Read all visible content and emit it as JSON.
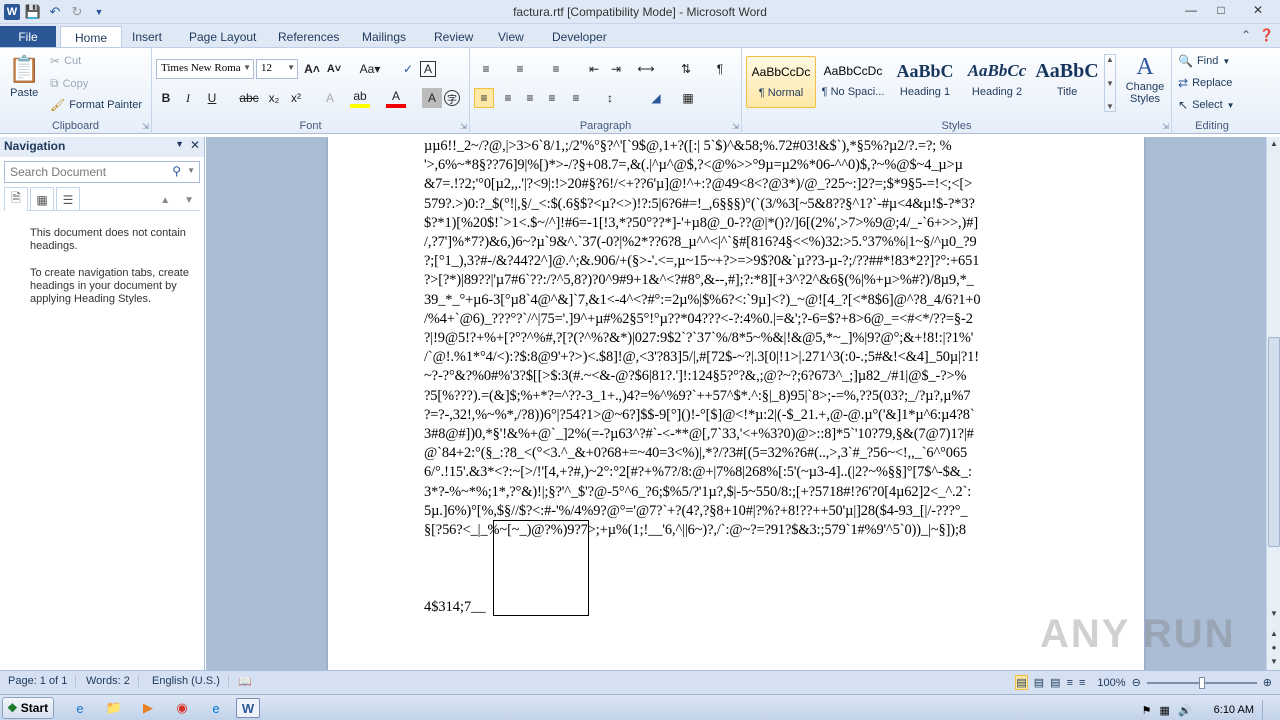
{
  "window": {
    "title": "factura.rtf [Compatibility Mode]  -  Microsoft Word"
  },
  "tabs": [
    "File",
    "Home",
    "Insert",
    "Page Layout",
    "References",
    "Mailings",
    "Review",
    "View",
    "Developer"
  ],
  "clipboard": {
    "paste": "Paste",
    "cut": "Cut",
    "copy": "Copy",
    "format_painter": "Format Painter",
    "label": "Clipboard"
  },
  "font": {
    "name": "Times New Roma",
    "size": "12",
    "label": "Font"
  },
  "paragraph": {
    "label": "Paragraph"
  },
  "styles": {
    "label": "Styles",
    "items": [
      {
        "preview": "AaBbCcDc",
        "name": "¶ Normal"
      },
      {
        "preview": "AaBbCcDc",
        "name": "¶ No Spaci..."
      },
      {
        "preview": "AaBbC",
        "name": "Heading 1"
      },
      {
        "preview": "AaBbCc",
        "name": "Heading 2"
      },
      {
        "preview": "AaBbC",
        "name": "Title"
      }
    ],
    "change": "Change Styles"
  },
  "editing": {
    "find": "Find",
    "replace": "Replace",
    "select": "Select",
    "label": "Editing"
  },
  "navigation": {
    "title": "Navigation",
    "search_placeholder": "Search Document",
    "msg1": "This document does not contain headings.",
    "msg2": "To create navigation tabs, create headings in your document by applying Heading Styles."
  },
  "document": {
    "lines": [
      "µµ6!!_2~/?@,|>3>6`8/1,;/2'%°§?^'[`9$@,1+?([:| 5`$)^&58;%.72#03!&$`),*§5%?µ2/?.=?; %",
      "'>,6%~*8§??76]9|%[)*>-/?§+08.7=,&(.|^µ^@$,?<@%>>°9µ=µ2%*06-^^0)$,?~%@$~4_µ>µ",
      "&7=.!?2;'°0[µ2,,.'|?<9|:!>20#§?6!/<+??6'µ]@!^+:?@49<8<?@3*)/@_?25~:]2?=;$*9§5-=!<;<[>",
      "579?.>)0:?_$(°!|,§/_<:$(.6§$?<µ?<>)!?:5|6?6#=!_,6§§§)°(`(3/%3[~5&8??§^1?`-#µ<4&µ!$-?*3?",
      "$?*1)[%20$!`>1<.$~/^]!#6=-1[!3,*?50°??*]-'+µ8@_0-??@|*()?/]6[(2%',>7>%9@;4/_-`6+>>,)#]",
      "/,?7']%*7?)&6,)6~?µ`9&^.`37(-0?|%2*??6?8_µ^^<|^`§#[816?4§<<%)32:>5.°37%%|1~§/^µ0_?9",
      "?;[°1_),3?#-/&?44?2^]@.^;&.906/+(§>-'.<=,µ~15~+?>=>9$?0&`µ??3-µ-?;/??##*!83*2?]?°:+651",
      "?>[?*)|89??|'µ7#6`??:/?^5,8?)?0^9#9+1&^<?#8°,&--,#];?:*8][+3^?2^&6§(%|%+µ>%#?)/8µ9,*_",
      "39_*_°+µ6-3[°µ8`4@^&]`7,&1<-4^<?#°:=2µ%|$%6?<:`9µ]<?)_~@![4_?[<*8$6]@^?8_4/6?1+0",
      "/%4+`@6)_???°?`/^|75='.]9^+µ#%2§5°!°µ??*04???<-?:4%0.|=&';?-6=$?+8>6@_=<#<*/??=§-2",
      "?|!9@5!?+%+[?°?^%#,?[?(?^%?&*)|027:9$2`?`37`%/8*5~%&|!&@5,*~_]%|9?@°;&+!8!:|?1%'",
      "/`@!.%1*°4/<):?$:8@9'+?>)<.$8]!@,<3'?83]5/|,#[72$-~?|.3[0|!1>|.271^3(:0-.;5#&!<&4]_50µ|?1!",
      "~?-?°&?%0#%'3?$[[>$:3(#.~<&-@?$6|81?.']!:124§5?°?&,;@?~?;6?673^_;]µ82_/#1|@$_-?>%",
      "?5[%???).=(&]$;%+*?=^??-3_1+.,)4?=%^%9?`++57^$*.^:§|_8)95|`8>;-=%,??5(03?;_/?µ?,µ%7",
      "?=?-,32!,%~%*,/?8))6°|?54?1>@~6?]$$-9[°]()!-°[$]@<!*µ:2|(-$_21.+,@-@.µ°('&]1*µ^6:µ4?8`",
      "3#8@#])0,*§'!&%+@`_]2%(=-?µ63^?#`-<-**@[,7`33,'<+%3?0)@>::8]*5`'10?79,§&(7@7)1?|#",
      "@`84+2:°(§_:?8_<(°<3.^_&+0?68+=~40=3<%)|,*?/?3#[(5=32%?6#(..,>,3`#_?56~<!,,_`6^°065",
      "6/°.!15'.&3*<?:~[>/!'[4,+?#,)~2°:°2[#?+%7?/8:@+|7%8|268%[:5'(~µ3-4]..(|2?~%§§]°[7$^-$&_:",
      "3*?-%~*%;1*,?°&)!|;§?'^_$'?@-5°^6_?6;$%5/?'1µ?,$|-5~550/8:;[+?5718#!?6'?0[4µ62]2<_^.2`:",
      "5µ.]6%)°[%,$§//$?<:#-'%/4%9?@°='@7?`+?(4?,?§8+10#|?%?+8!??++50'µ|]28($4-93_[|/-???°_",
      "§[?56?<_|_%~[~_)@?%)9?7>;+µ%(1;!__'6,^||6~)?,/`:@~?=?91?$&3:;579`1#%9'^5`0))_|~§]);8"
    ],
    "footer_text": "4$314;7__"
  },
  "status": {
    "page": "Page: 1 of 1",
    "words": "Words: 2",
    "lang": "English (U.S.)",
    "zoom": "100%"
  },
  "taskbar": {
    "start": "Start",
    "clock": "6:10 AM"
  },
  "watermark": "ANY RUN"
}
